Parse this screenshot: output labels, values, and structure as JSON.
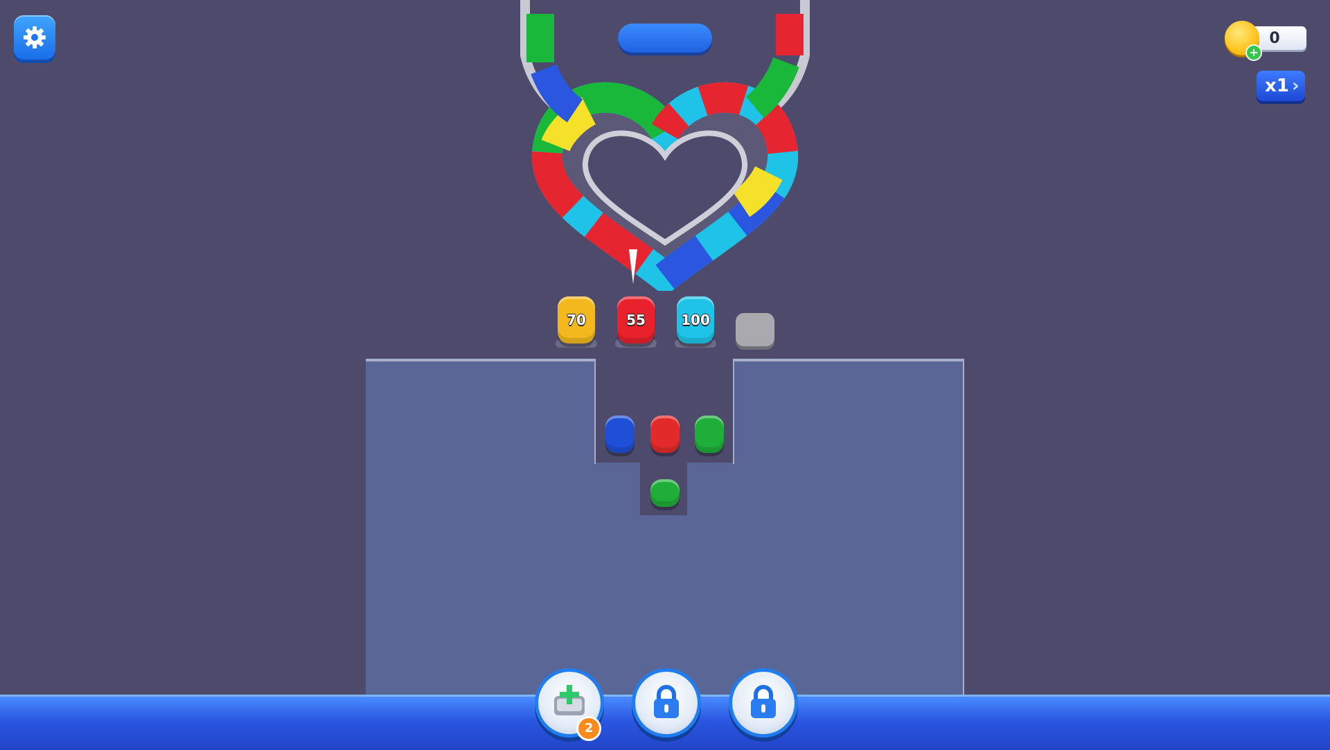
{
  "hud": {
    "coins": "0",
    "speed_label": "x1"
  },
  "queue": [
    {
      "value": "70",
      "color": "#f2b81e"
    },
    {
      "value": "55",
      "color": "#e8212c"
    },
    {
      "value": "100",
      "color": "#1fc3e8"
    }
  ],
  "waiting_cars": [
    {
      "color": "#1f4fd6"
    },
    {
      "color": "#e32a2a"
    },
    {
      "color": "#1fae3a"
    },
    {
      "color": "#1fae3a"
    }
  ],
  "boosters": [
    {
      "name": "add-slot",
      "count": "2",
      "locked": false
    },
    {
      "name": "locked-1",
      "locked": true
    },
    {
      "name": "locked-2",
      "locked": true
    }
  ],
  "colors": {
    "background": "#4d4a6b",
    "board": "#5a6695",
    "accent_blue": "#1f7df0"
  }
}
